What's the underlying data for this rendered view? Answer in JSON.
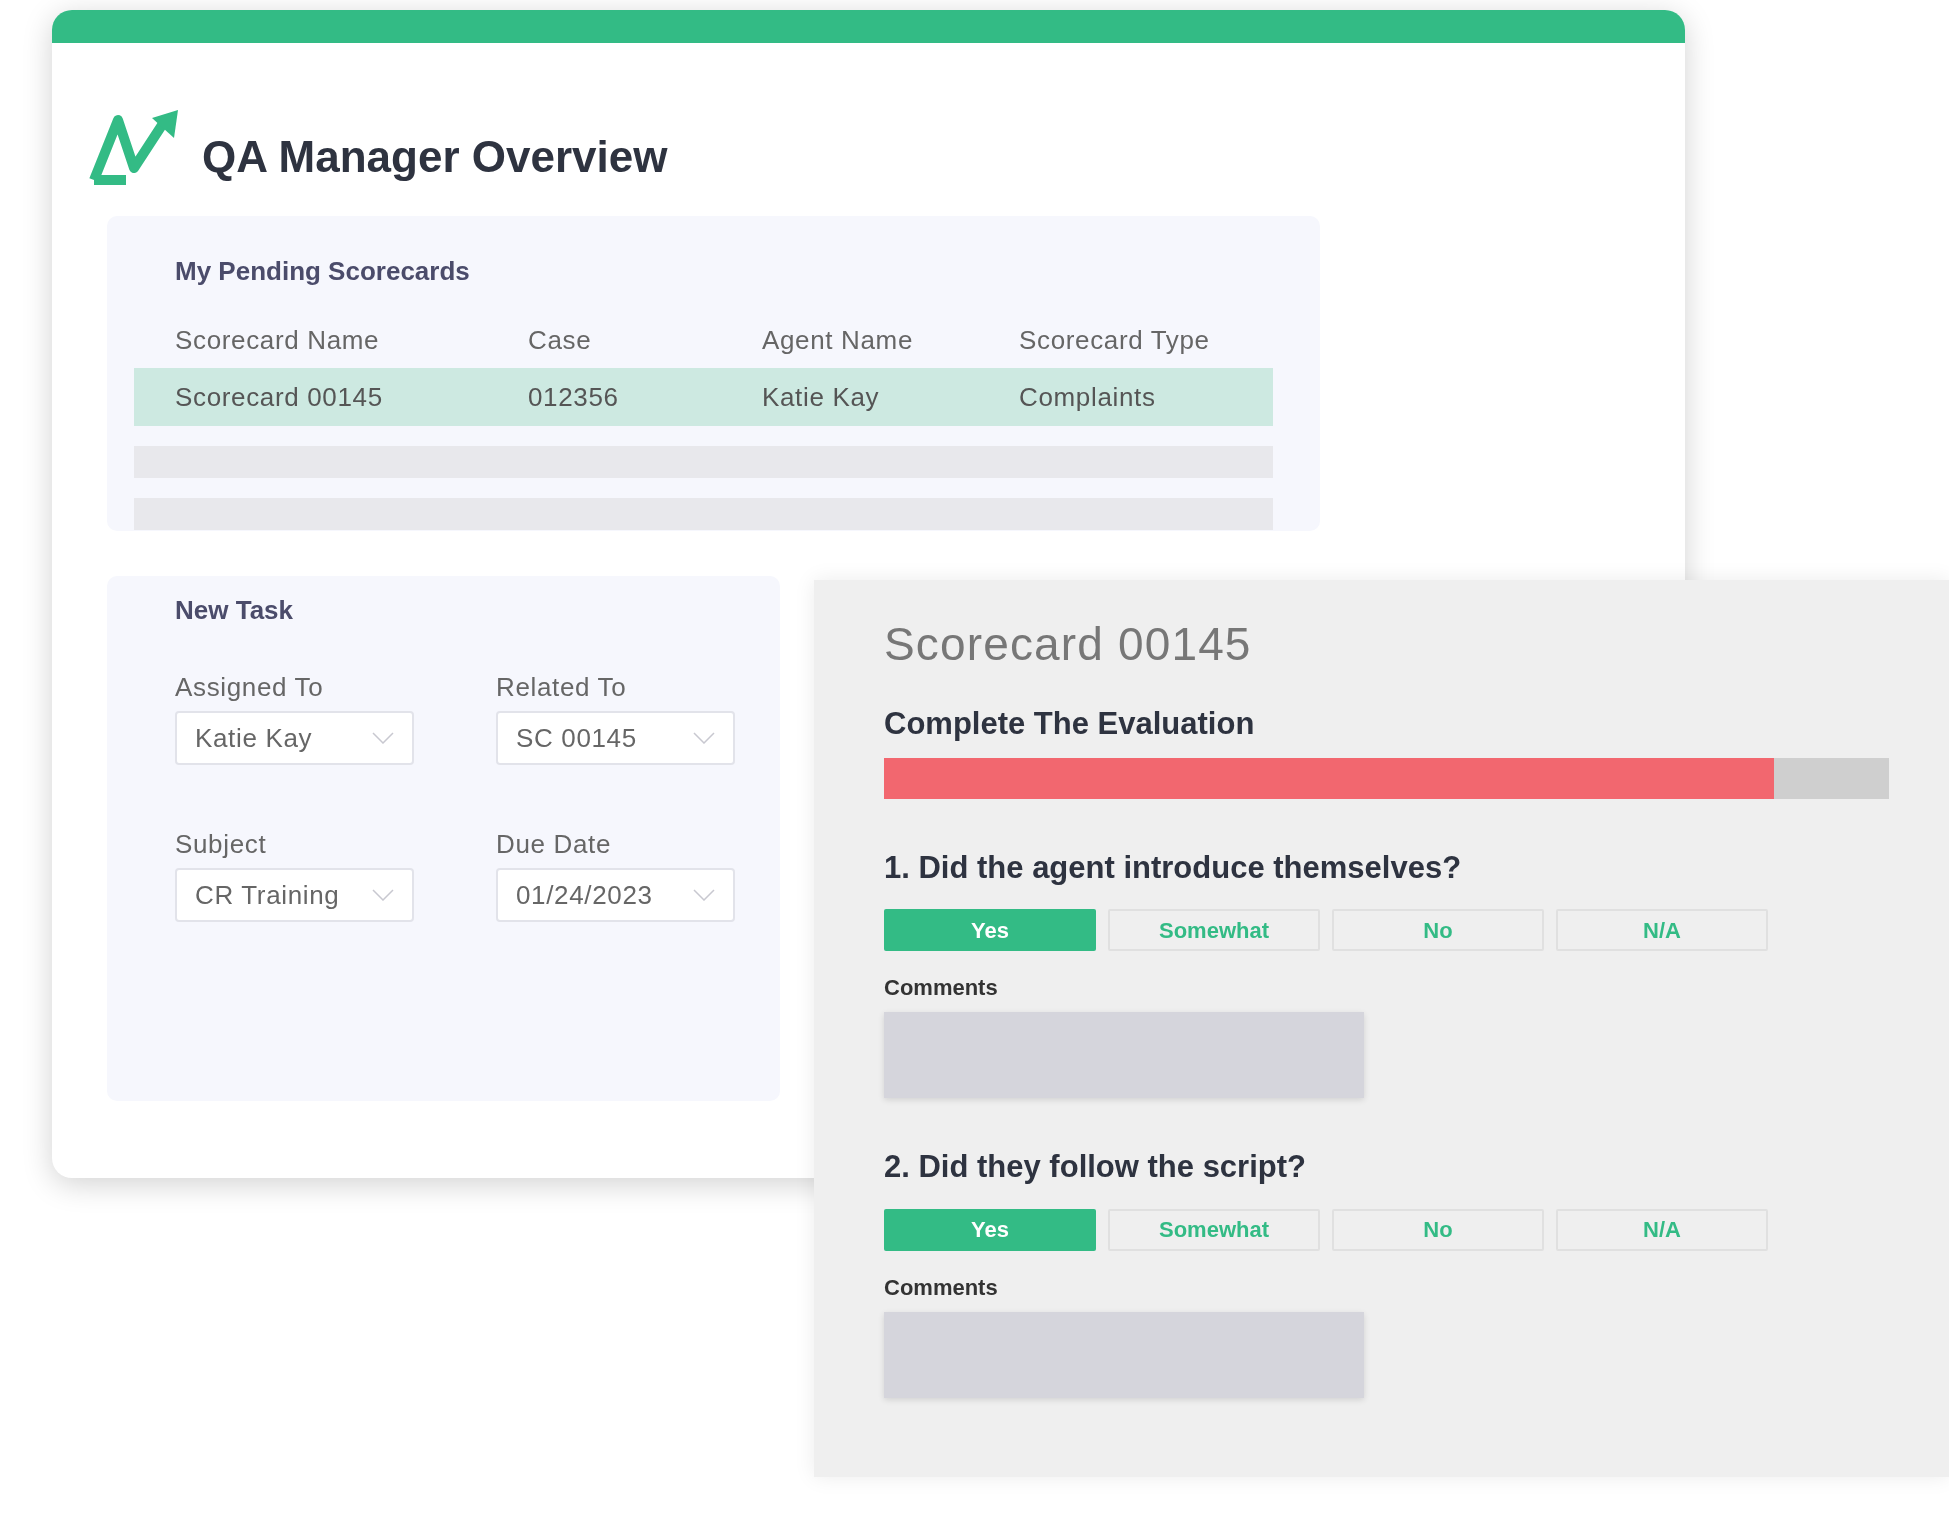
{
  "overview": {
    "title": "QA Manager Overview",
    "pending": {
      "title": "My Pending Scorecards",
      "columns": [
        "Scorecard Name",
        "Case",
        "Agent Name",
        "Scorecard Type"
      ],
      "rows": [
        {
          "kind": "data",
          "selected": true,
          "cells": [
            "Scorecard 00145",
            "012356",
            "Katie Kay",
            "Complaints"
          ]
        },
        {
          "kind": "blank",
          "selected": false
        },
        {
          "kind": "blank",
          "selected": false
        }
      ]
    },
    "new_task": {
      "title": "New Task",
      "fields": [
        {
          "label": "Assigned To",
          "value": "Katie Kay"
        },
        {
          "label": "Related To",
          "value": "SC 00145"
        },
        {
          "label": "Subject",
          "value": "CR Training"
        },
        {
          "label": "Due Date",
          "value": "01/24/2023"
        }
      ]
    }
  },
  "scorecard": {
    "title": "Scorecard 00145",
    "progress_label": "Complete The Evaluation",
    "level": 0.886,
    "questions": [
      {
        "text": "1. Did the agent introduce themselves?",
        "options": [
          {
            "label": "Yes",
            "selected": true
          },
          {
            "label": "Somewhat",
            "selected": false
          },
          {
            "label": "No",
            "selected": false
          },
          {
            "label": "N/A",
            "selected": false
          }
        ],
        "comments_label": "Comments"
      },
      {
        "text": "2. Did they follow the script?",
        "options": [
          {
            "label": "Yes",
            "selected": true
          },
          {
            "label": "Somewhat",
            "selected": false
          },
          {
            "label": "No",
            "selected": false
          },
          {
            "label": "N/A",
            "selected": false
          }
        ],
        "comments_label": "Comments"
      }
    ]
  }
}
